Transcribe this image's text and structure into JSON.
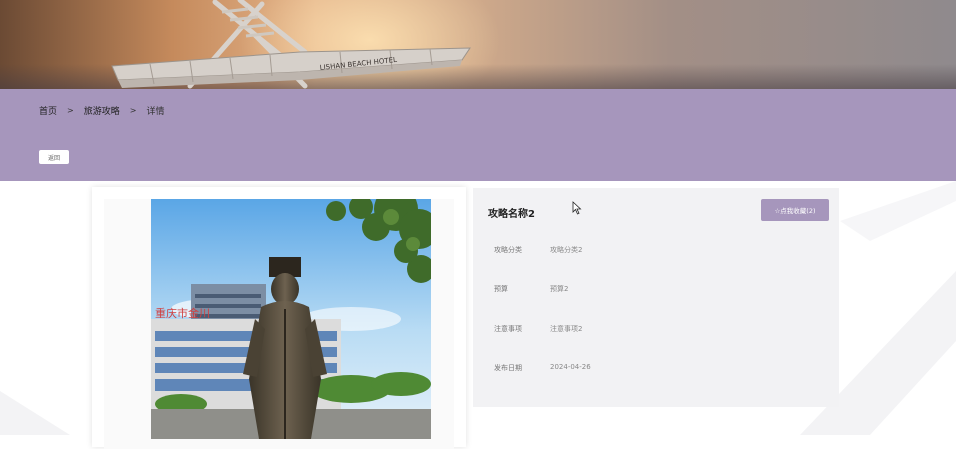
{
  "breadcrumb": {
    "home": "首页",
    "separator": ">",
    "section": "旅游攻略",
    "current": "详情"
  },
  "back_button": "返回",
  "detail": {
    "title": "攻略名称2",
    "favorite_button": "☆点我收藏(2)",
    "fields": [
      {
        "label": "攻略分类",
        "value": "攻略分类2"
      },
      {
        "label": "预算",
        "value": "预算2"
      },
      {
        "label": "注意事项",
        "value": "注意事项2"
      },
      {
        "label": "发布日期",
        "value": "2024-04-26"
      }
    ]
  },
  "banner_sign_text": "LISHAN BEACH HOTEL",
  "photo_sign_text": "重庆市金川",
  "colors": {
    "accent": "#a696bc",
    "panel": "#f2f2f4"
  }
}
